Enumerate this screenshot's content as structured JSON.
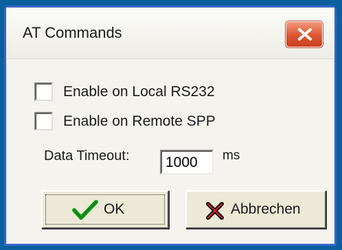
{
  "dialog": {
    "title": "AT Commands",
    "close_icon": "close-icon",
    "options": [
      {
        "label": "Enable on Local RS232",
        "checked": false
      },
      {
        "label": "Enable on Remote SPP",
        "checked": false
      }
    ],
    "timeout": {
      "label": "Data Timeout:",
      "value": "1000",
      "unit": "ms"
    },
    "buttons": {
      "ok": {
        "label": "OK",
        "icon": "checkmark-icon"
      },
      "cancel": {
        "label": "Abbrechen",
        "icon": "cross-icon"
      }
    }
  },
  "colors": {
    "desktop": "#0a5f9e",
    "window_border": "#3a66c8",
    "close_button": "#dd5530",
    "check_green": "#1a9a1a"
  }
}
